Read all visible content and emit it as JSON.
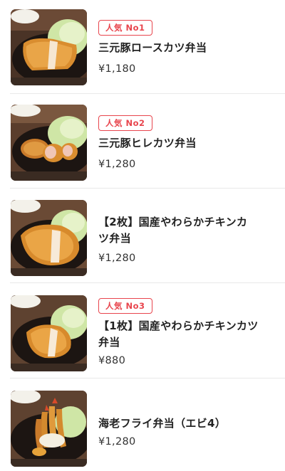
{
  "menu": {
    "items": [
      {
        "badge": "人気 No1",
        "name_lines": [
          "三元豚ロースカツ弁当"
        ],
        "price": "¥1,180",
        "image": "pork-loin-cutlet-photo"
      },
      {
        "badge": "人気 No2",
        "name_lines": [
          "三元豚ヒレカツ弁当"
        ],
        "price": "¥1,280",
        "image": "pork-fillet-cutlet-photo"
      },
      {
        "badge": "",
        "name_lines": [
          "【2枚】国産やわらかチキンカ",
          "ツ弁当"
        ],
        "price": "¥1,280",
        "image": "chicken-cutlet-two-photo"
      },
      {
        "badge": "人気 No3",
        "name_lines": [
          "【1枚】国産やわらかチキンカツ",
          "弁当"
        ],
        "price": "¥880",
        "image": "chicken-cutlet-one-photo"
      },
      {
        "badge": "",
        "name_lines": [
          "海老フライ弁当（エビ4）"
        ],
        "price": "¥1,280",
        "image": "fried-shrimp-photo"
      }
    ]
  }
}
